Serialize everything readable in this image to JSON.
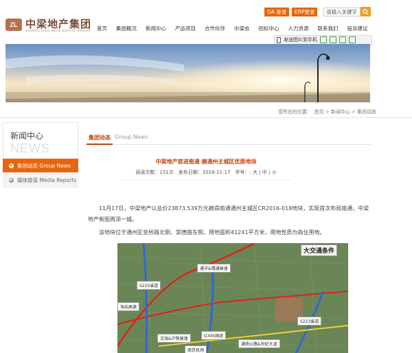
{
  "header": {
    "logo_mark": "ZL",
    "logo_cn": "中梁地产集团",
    "logo_en": "ZHONGLIANG REAL ESTATE GROUP",
    "oa_label": "OA 登录",
    "erp_label": "ERP登录",
    "search_placeholder": "请输入关键字"
  },
  "nav": [
    "首页",
    "集团概况",
    "新闻中心",
    "产品项目",
    "合作伙伴",
    "中梁会",
    "招标中心",
    "人力资源",
    "联系我们",
    "投诉建议"
  ],
  "share": {
    "label": "发送图片到手机"
  },
  "breadcrumb": "您所在的位置：　首页 > 新闻中心 > 集团动态",
  "sidebar": {
    "title": "新闻中心",
    "title_en": "NEWS",
    "items": [
      {
        "label": "集团动态  Group News",
        "active": true
      },
      {
        "label": "媒体报道  Media Reports",
        "active": false
      }
    ]
  },
  "tabs": {
    "cn": "集团动态",
    "en": "Group News"
  },
  "article": {
    "title": "中梁地产首进南通 摘通州主城区优质地块",
    "meta": "阅读次数：151次　发布日期：2016-11-17　字号：: 大 | 中 | 小",
    "p1": "11月17日，中梁地产以总价23873.539万元摘得南通通州主城区CR2016-018地块，实现首次布局南通，中梁地产新图再添一城。",
    "p2": "该地块位于通州区金桥路北侧、崇德路东侧，用地面积41241平方米，用地性质为商住用地。"
  },
  "map": {
    "caption": "大交通条件",
    "labels": [
      "通洋&锡通高速",
      "S225省道",
      "海启高速",
      "S223省道",
      "沈海&沪陕高速",
      "G345国道",
      "南京机场",
      "通扬公路&世纪大道"
    ]
  }
}
